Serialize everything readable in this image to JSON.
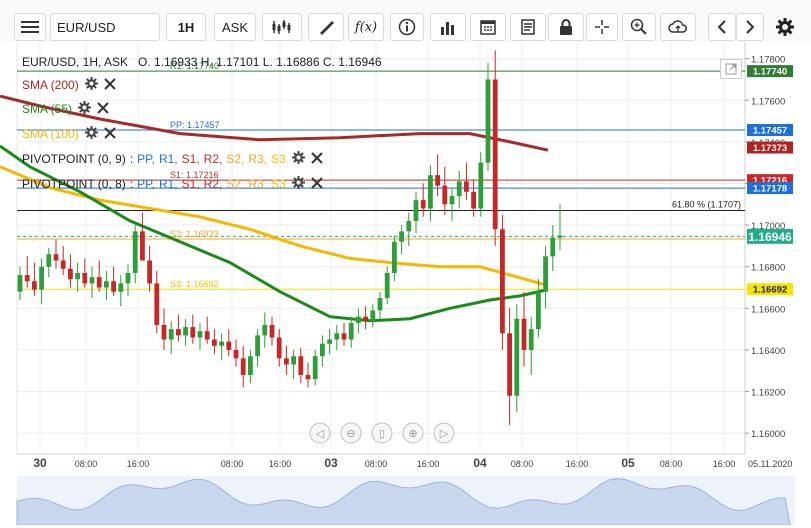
{
  "toolbar": {
    "symbol": "EUR/USD",
    "timeframe": "1H",
    "price_type": "ASK",
    "icons": [
      "menu-icon",
      "candles-icon",
      "draw-icon",
      "fx-icon",
      "info-icon",
      "bars-icon",
      "calendar-icon",
      "news-icon",
      "lock-icon",
      "crosshair-icon",
      "zoom-icon",
      "cloud-icon",
      "left-arrow-icon",
      "right-arrow-icon",
      "settings-icon"
    ]
  },
  "header": {
    "instrument": "EUR/USD, 1H, ASK",
    "ohlc": "O. 1.16933 H. 1.17101 L. 1.16886 C. 1.16946"
  },
  "indicators": [
    {
      "label": "SMA (200)",
      "color": "#b22222"
    },
    {
      "label": "SMA (55)",
      "color": "#1a8a1a"
    },
    {
      "label": "SMA (100)",
      "color": "#f5b800"
    }
  ],
  "pivots": [
    {
      "label": "PIVOTPOINT (0, 9)"
    },
    {
      "label": "PIVOTPOINT (0, 8)"
    }
  ],
  "pivot_levels": [
    {
      "name": "PP",
      "color": "#1e6fd9"
    },
    {
      "name": "R1",
      "color": "#1e6fd9"
    },
    {
      "name": "S1",
      "color": "#c62828"
    },
    {
      "name": "R2",
      "color": "#c62828"
    },
    {
      "name": "S2",
      "color": "#f5a623"
    },
    {
      "name": "R3",
      "color": "#f5a623"
    },
    {
      "name": "S3",
      "color": "#f5c400"
    }
  ],
  "level_labels": [
    {
      "text": "R1: 1.17740",
      "price": 1.1774,
      "color": "#2e7d32"
    },
    {
      "text": "PP: 1.17457",
      "price": 1.17457,
      "color": "#1e6fd9"
    },
    {
      "text": "S1: 1.17216",
      "price": 1.17216,
      "color": "#c62828"
    },
    {
      "text": "S2: 1.16933",
      "price": 1.16933,
      "color": "#f5a623"
    },
    {
      "text": "S3: 1.16692",
      "price": 1.16692,
      "color": "#f5c400"
    }
  ],
  "fib_label": "61.80 % (1.1707)",
  "date_stamp": "05.11.2020",
  "price_tags": [
    {
      "text": "1.17740",
      "price": 1.1774,
      "bg": "#2e7d32",
      "fg": "#ffffff"
    },
    {
      "text": "1.17457",
      "price": 1.17457,
      "bg": "#1e6fd9",
      "fg": "#ffffff"
    },
    {
      "text": "1.17373",
      "price": 1.17373,
      "bg": "#b22222",
      "fg": "#ffffff"
    },
    {
      "text": "1.17216",
      "price": 1.17216,
      "bg": "#c62828",
      "fg": "#ffffff"
    },
    {
      "text": "1.17178",
      "price": 1.17178,
      "bg": "#1e6fd9",
      "fg": "#ffffff"
    },
    {
      "text": "1.16946",
      "price": 1.16946,
      "bg": "#1fae8a",
      "fg": "#ffffff"
    },
    {
      "text": "1.16692",
      "price": 1.16692,
      "bg": "#f5e400",
      "fg": "#222222"
    }
  ],
  "chart_data": {
    "type": "candlestick",
    "title": "EUR/USD, 1H, ASK",
    "ylim": [
      1.159,
      1.1788
    ],
    "y_ticks": [
      "1.16000",
      "1.16200",
      "1.16400",
      "1.16600",
      "1.16800",
      "1.17000",
      "1.17200",
      "1.17400",
      "1.17600",
      "1.17800"
    ],
    "x_ticks": [
      "30",
      "08:00",
      "16:00",
      "08:00",
      "16:00",
      "03",
      "08:00",
      "16:00",
      "04",
      "08:00",
      "16:00",
      "05",
      "08:00",
      "16:00"
    ],
    "horizontal_lines": [
      {
        "name": "R1",
        "value": 1.1774,
        "color": "#2e7d32"
      },
      {
        "name": "PP",
        "value": 1.17457,
        "color": "#1e6fd9"
      },
      {
        "name": "S1",
        "value": 1.17216,
        "color": "#c62828"
      },
      {
        "name": "R1 (0,8)",
        "value": 1.17178,
        "color": "#1e6fd9"
      },
      {
        "name": "61.80 %",
        "value": 1.1707,
        "color": "#222222"
      },
      {
        "name": "S2",
        "value": 1.16933,
        "color": "#f5a623"
      },
      {
        "name": "S3",
        "value": 1.16692,
        "color": "#f5e400"
      }
    ],
    "candles": [
      [
        1.1668,
        1.168,
        1.1664,
        1.1676
      ],
      [
        1.1676,
        1.1685,
        1.167,
        1.1673
      ],
      [
        1.1673,
        1.1682,
        1.1666,
        1.1669
      ],
      [
        1.1669,
        1.1684,
        1.1662,
        1.168
      ],
      [
        1.168,
        1.1689,
        1.1675,
        1.1686
      ],
      [
        1.1686,
        1.1693,
        1.1679,
        1.1683
      ],
      [
        1.1683,
        1.169,
        1.1676,
        1.1679
      ],
      [
        1.1679,
        1.1686,
        1.167,
        1.1674
      ],
      [
        1.1674,
        1.1682,
        1.1668,
        1.1677
      ],
      [
        1.1677,
        1.1684,
        1.167,
        1.1672
      ],
      [
        1.1672,
        1.168,
        1.1665,
        1.1675
      ],
      [
        1.1675,
        1.1683,
        1.1668,
        1.167
      ],
      [
        1.167,
        1.1678,
        1.1664,
        1.1673
      ],
      [
        1.1673,
        1.168,
        1.1666,
        1.1668
      ],
      [
        1.1668,
        1.1676,
        1.1661,
        1.1672
      ],
      [
        1.1672,
        1.1681,
        1.1666,
        1.1677
      ],
      [
        1.1677,
        1.17,
        1.1672,
        1.1697
      ],
      [
        1.1697,
        1.1706,
        1.169,
        1.1683
      ],
      [
        1.1683,
        1.169,
        1.1668,
        1.1672
      ],
      [
        1.1672,
        1.1678,
        1.1648,
        1.1652
      ],
      [
        1.1652,
        1.166,
        1.164,
        1.1645
      ],
      [
        1.1645,
        1.1654,
        1.1638,
        1.165
      ],
      [
        1.165,
        1.1657,
        1.1644,
        1.1647
      ],
      [
        1.1647,
        1.1655,
        1.1642,
        1.1651
      ],
      [
        1.1651,
        1.1657,
        1.1643,
        1.1646
      ],
      [
        1.1646,
        1.1653,
        1.164,
        1.1649
      ],
      [
        1.1649,
        1.1656,
        1.1643,
        1.1645
      ],
      [
        1.1645,
        1.165,
        1.1638,
        1.1642
      ],
      [
        1.1642,
        1.1648,
        1.1635,
        1.1644
      ],
      [
        1.1644,
        1.165,
        1.1637,
        1.164
      ],
      [
        1.164,
        1.1645,
        1.1632,
        1.1636
      ],
      [
        1.1636,
        1.1642,
        1.1622,
        1.1628
      ],
      [
        1.1628,
        1.164,
        1.1624,
        1.1637
      ],
      [
        1.1637,
        1.165,
        1.1632,
        1.1647
      ],
      [
        1.1647,
        1.1658,
        1.1641,
        1.1652
      ],
      [
        1.1652,
        1.1656,
        1.1642,
        1.1646
      ],
      [
        1.1646,
        1.165,
        1.1632,
        1.1636
      ],
      [
        1.1636,
        1.1642,
        1.1628,
        1.1633
      ],
      [
        1.1633,
        1.164,
        1.1626,
        1.1637
      ],
      [
        1.1637,
        1.1641,
        1.1624,
        1.1628
      ],
      [
        1.1628,
        1.1634,
        1.1622,
        1.1626
      ],
      [
        1.1626,
        1.164,
        1.1623,
        1.1637
      ],
      [
        1.1637,
        1.1647,
        1.1632,
        1.1643
      ],
      [
        1.1643,
        1.165,
        1.1638,
        1.1645
      ],
      [
        1.1645,
        1.1652,
        1.164,
        1.1648
      ],
      [
        1.1648,
        1.1653,
        1.1642,
        1.1645
      ],
      [
        1.1645,
        1.1656,
        1.1641,
        1.1653
      ],
      [
        1.1653,
        1.166,
        1.1648,
        1.1656
      ],
      [
        1.1656,
        1.1661,
        1.165,
        1.1654
      ],
      [
        1.1654,
        1.1662,
        1.1651,
        1.1659
      ],
      [
        1.1659,
        1.1668,
        1.1655,
        1.1665
      ],
      [
        1.1665,
        1.168,
        1.1662,
        1.1677
      ],
      [
        1.1677,
        1.1695,
        1.1673,
        1.1692
      ],
      [
        1.1692,
        1.17,
        1.1686,
        1.1697
      ],
      [
        1.1697,
        1.1706,
        1.169,
        1.1702
      ],
      [
        1.1702,
        1.1716,
        1.1696,
        1.1712
      ],
      [
        1.1712,
        1.172,
        1.1704,
        1.1708
      ],
      [
        1.1708,
        1.1729,
        1.1702,
        1.1724
      ],
      [
        1.1724,
        1.1734,
        1.1714,
        1.1719
      ],
      [
        1.1719,
        1.1728,
        1.1705,
        1.171
      ],
      [
        1.171,
        1.1718,
        1.1702,
        1.1714
      ],
      [
        1.1714,
        1.1726,
        1.1708,
        1.1721
      ],
      [
        1.1721,
        1.173,
        1.1712,
        1.1716
      ],
      [
        1.1716,
        1.1722,
        1.1704,
        1.1708
      ],
      [
        1.1708,
        1.1735,
        1.1704,
        1.173
      ],
      [
        1.173,
        1.1778,
        1.1726,
        1.177
      ],
      [
        1.177,
        1.1784,
        1.169,
        1.1698
      ],
      [
        1.1698,
        1.1705,
        1.164,
        1.1648
      ],
      [
        1.1648,
        1.166,
        1.1604,
        1.1618
      ],
      [
        1.1618,
        1.1662,
        1.161,
        1.1655
      ],
      [
        1.1655,
        1.1668,
        1.1632,
        1.164
      ],
      [
        1.164,
        1.1656,
        1.1628,
        1.165
      ],
      [
        1.165,
        1.1674,
        1.1646,
        1.1668
      ],
      [
        1.1668,
        1.169,
        1.166,
        1.1685
      ],
      [
        1.1685,
        1.17,
        1.1678,
        1.1694
      ],
      [
        1.1694,
        1.171,
        1.1688,
        1.1695
      ]
    ],
    "sma200": [
      [
        0,
        1.1762
      ],
      [
        42,
        1.1757
      ],
      [
        100,
        1.1751
      ],
      [
        180,
        1.1744
      ],
      [
        260,
        1.1741
      ],
      [
        340,
        1.1742
      ],
      [
        420,
        1.1744
      ],
      [
        470,
        1.1744
      ],
      [
        510,
        1.174
      ],
      [
        548,
        1.1736
      ]
    ],
    "sma100": [
      [
        0,
        1.1728
      ],
      [
        50,
        1.1718
      ],
      [
        100,
        1.1712
      ],
      [
        150,
        1.1708
      ],
      [
        200,
        1.1704
      ],
      [
        250,
        1.1698
      ],
      [
        300,
        1.169
      ],
      [
        350,
        1.1684
      ],
      [
        390,
        1.1682
      ],
      [
        440,
        1.168
      ],
      [
        480,
        1.168
      ],
      [
        510,
        1.1676
      ],
      [
        548,
        1.1671
      ]
    ],
    "sma55": [
      [
        0,
        1.1738
      ],
      [
        30,
        1.1728
      ],
      [
        80,
        1.1716
      ],
      [
        130,
        1.1702
      ],
      [
        180,
        1.1692
      ],
      [
        230,
        1.1682
      ],
      [
        280,
        1.1668
      ],
      [
        330,
        1.1656
      ],
      [
        370,
        1.1654
      ],
      [
        410,
        1.1655
      ],
      [
        450,
        1.166
      ],
      [
        490,
        1.1664
      ],
      [
        520,
        1.1666
      ],
      [
        548,
        1.1669
      ]
    ]
  }
}
